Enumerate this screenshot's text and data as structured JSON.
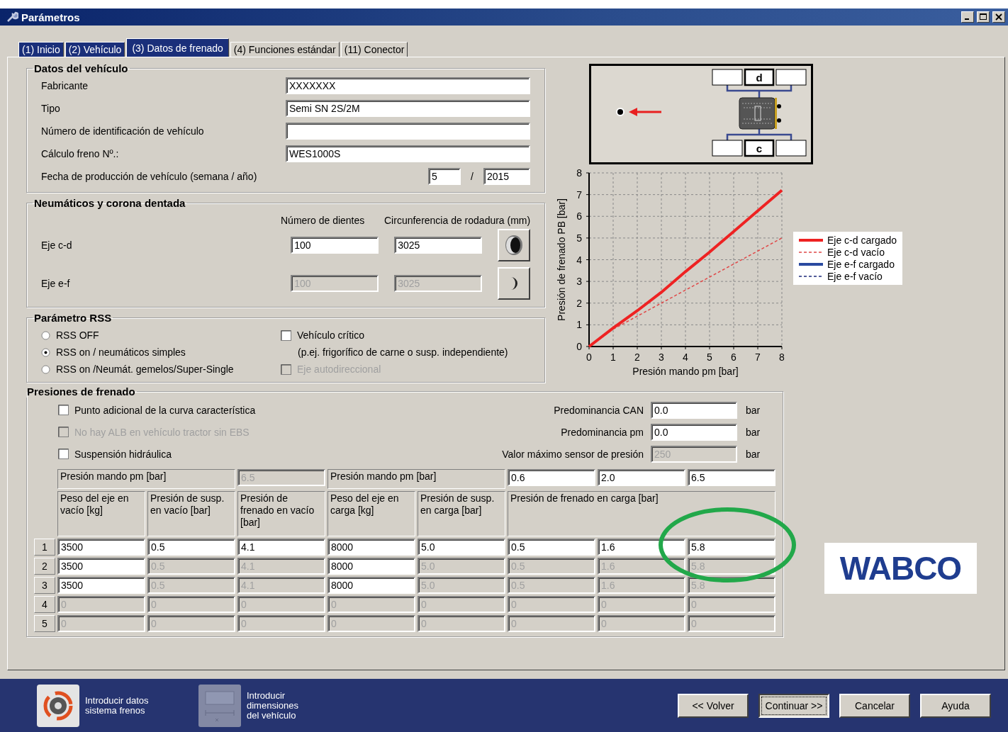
{
  "window": {
    "title": "Parámetros"
  },
  "tabs": [
    {
      "label": "(1) Inicio",
      "selected": false,
      "visited": true
    },
    {
      "label": "(2) Vehículo",
      "selected": false,
      "visited": true
    },
    {
      "label": "(3) Datos de frenado",
      "selected": true,
      "visited": true
    },
    {
      "label": "(4) Funciones estándar",
      "selected": false,
      "visited": false
    },
    {
      "label": "(11) Conector",
      "selected": false,
      "visited": false
    }
  ],
  "vehicle_data": {
    "title": "Datos del vehículo",
    "fields": [
      {
        "label": "Fabricante",
        "value": "XXXXXXX"
      },
      {
        "label": "Tipo",
        "value": "Semi SN 2S/2M"
      },
      {
        "label": "Número de identificación de vehículo"
      },
      {
        "label": "Cálculo freno Nº.:",
        "value": "WES1000S"
      }
    ],
    "production_date": {
      "label": "Fecha de producción de vehículo (semana / año)",
      "week": "5",
      "separator": "/",
      "year": "2015"
    }
  },
  "tires": {
    "title": "Neumáticos y corona dentada",
    "columns": [
      "Número de dientes",
      "Circunferencia de rodadura (mm)"
    ],
    "rows": [
      {
        "label": "Eje c-d",
        "teeth": "100",
        "circumference": "3025",
        "disabled": false
      },
      {
        "label": "Eje e-f",
        "teeth": "100",
        "circumference": "3025",
        "disabled": true
      }
    ]
  },
  "rss": {
    "title": "Parámetro RSS",
    "options": [
      {
        "label": "RSS OFF",
        "selected": false
      },
      {
        "label": "RSS on / neumáticos simples",
        "selected": true
      },
      {
        "label": "RSS on /Neumát. gemelos/Super-Single",
        "selected": false
      }
    ],
    "checkboxes": [
      {
        "label": "Vehículo crítico",
        "checked": false,
        "disabled": false,
        "note": "(p.ej. frigorífico de carne o susp. independiente)"
      },
      {
        "label": "Eje autodireccional",
        "checked": false,
        "disabled": true
      }
    ]
  },
  "axle_diagram": {
    "top_label": "d",
    "bottom_label": "c"
  },
  "chart": {
    "chart_data": {
      "type": "line",
      "grid": true,
      "xlabel": "Presión mando pm [bar]",
      "ylabel": "Presión de frenado PB [bar]",
      "x": [
        0,
        1,
        2,
        3,
        4,
        5,
        6,
        7,
        8
      ],
      "xlim": [
        0,
        8
      ],
      "ylim": [
        0,
        8
      ],
      "xticks": [
        0,
        1,
        2,
        3,
        4,
        5,
        6,
        7,
        8
      ],
      "yticks": [
        0,
        1,
        2,
        3,
        4,
        5,
        6,
        7,
        8
      ],
      "series": [
        {
          "name": "Eje c-d cargado",
          "color": "#ee2222",
          "line_style": "solid",
          "values": [
            0,
            0.85,
            1.65,
            2.5,
            3.45,
            4.35,
            5.3,
            6.25,
            7.2
          ]
        },
        {
          "name": "Eje c-d vacío",
          "color": "#e04848",
          "line_style": "dashed",
          "values": [
            0,
            0.8,
            1.4,
            2.0,
            2.6,
            3.2,
            3.8,
            4.4,
            5.0
          ]
        },
        {
          "name": "Eje e-f cargado",
          "color": "#2a4aa0",
          "line_style": "solid",
          "values": [
            null,
            null,
            null,
            null,
            null,
            null,
            null,
            null,
            null
          ]
        },
        {
          "name": "Eje e-f vacío",
          "color": "#1c2a7a",
          "line_style": "dashed",
          "values": [
            null,
            null,
            null,
            null,
            null,
            null,
            null,
            null,
            null
          ]
        }
      ]
    }
  },
  "brake_pressures": {
    "title": "Presiones de frenado",
    "checkboxes": [
      {
        "label": "Punto adicional de la curva característica",
        "checked": false,
        "disabled": false
      },
      {
        "label": "No hay ALB en vehículo tractor sin EBS",
        "checked": false,
        "disabled": true
      },
      {
        "label": "Suspensión hidráulica",
        "checked": false,
        "disabled": false
      }
    ],
    "settings": [
      {
        "label": "Predominancia CAN",
        "value": "0.0",
        "unit": "bar",
        "disabled": false
      },
      {
        "label": "Predominancia pm",
        "value": "0.0",
        "unit": "bar",
        "disabled": false
      },
      {
        "label": "Valor máximo sensor de presión",
        "value": "250",
        "unit": "bar",
        "disabled": true
      }
    ],
    "table": {
      "pm_label_empty": "Presión mando pm [bar]",
      "pm_value_empty": {
        "value": "6.5",
        "disabled": true
      },
      "pm_label_loaded": "Presión mando pm [bar]",
      "pm_values_loaded": [
        {
          "value": "0.6",
          "disabled": false
        },
        {
          "value": "2.0",
          "disabled": false
        },
        {
          "value": "6.5",
          "disabled": false
        }
      ],
      "columns": [
        "Peso del eje en vacío [kg]",
        "Presión de susp. en vacío [bar]",
        "Presión de frenado en vacío [bar]",
        "Peso del eje en carga [kg]",
        "Presión de susp. en carga [bar]"
      ],
      "loaded_header": "Presión de frenado en carga [bar]",
      "rows": [
        {
          "number": "1",
          "cells": [
            {
              "value": "3500",
              "disabled": false
            },
            {
              "value": "0.5",
              "disabled": false
            },
            {
              "value": "4.1",
              "disabled": false
            },
            {
              "value": "8000",
              "disabled": false
            },
            {
              "value": "5.0",
              "disabled": false
            },
            {
              "value": "0.5",
              "disabled": false
            },
            {
              "value": "1.6",
              "disabled": false
            },
            {
              "value": "5.8",
              "disabled": false
            }
          ]
        },
        {
          "number": "2",
          "cells": [
            {
              "value": "3500",
              "disabled": false
            },
            {
              "value": "0.5",
              "disabled": true
            },
            {
              "value": "4.1",
              "disabled": true
            },
            {
              "value": "8000",
              "disabled": false
            },
            {
              "value": "5.0",
              "disabled": true
            },
            {
              "value": "0.5",
              "disabled": true
            },
            {
              "value": "1.6",
              "disabled": true
            },
            {
              "value": "5.8",
              "disabled": true
            }
          ]
        },
        {
          "number": "3",
          "cells": [
            {
              "value": "3500",
              "disabled": false
            },
            {
              "value": "0.5",
              "disabled": true
            },
            {
              "value": "4.1",
              "disabled": true
            },
            {
              "value": "8000",
              "disabled": false
            },
            {
              "value": "5.0",
              "disabled": true
            },
            {
              "value": "0.5",
              "disabled": true
            },
            {
              "value": "1.6",
              "disabled": true
            },
            {
              "value": "5.8",
              "disabled": true
            }
          ]
        },
        {
          "number": "4",
          "cells": [
            {
              "value": "0",
              "disabled": true
            },
            {
              "value": "0",
              "disabled": true
            },
            {
              "value": "0",
              "disabled": true
            },
            {
              "value": "0",
              "disabled": true
            },
            {
              "value": "0",
              "disabled": true
            },
            {
              "value": "0",
              "disabled": true
            },
            {
              "value": "0",
              "disabled": true
            },
            {
              "value": "0",
              "disabled": true
            }
          ]
        },
        {
          "number": "5",
          "cells": [
            {
              "value": "0",
              "disabled": true
            },
            {
              "value": "0",
              "disabled": true
            },
            {
              "value": "0",
              "disabled": true
            },
            {
              "value": "0",
              "disabled": true
            },
            {
              "value": "0",
              "disabled": true
            },
            {
              "value": "0",
              "disabled": true
            },
            {
              "value": "0",
              "disabled": true
            },
            {
              "value": "0",
              "disabled": true
            }
          ]
        }
      ]
    },
    "highlight": {
      "kind": "ellipse",
      "color": "#22a84a"
    }
  },
  "logo": "WABCO",
  "footer": {
    "shortcuts": [
      {
        "kind": "brakes",
        "label": "Introducir datos sistema frenos",
        "disabled": false
      },
      {
        "kind": "dimensions",
        "label": "Introducir dimensiones del vehículo",
        "disabled": true
      }
    ],
    "buttons": [
      {
        "label": "<< Volver",
        "focused": false
      },
      {
        "label": "Continuar >>",
        "focused": true
      },
      {
        "label": "Cancelar",
        "focused": false
      },
      {
        "label": "Ayuda",
        "focused": false
      }
    ]
  }
}
